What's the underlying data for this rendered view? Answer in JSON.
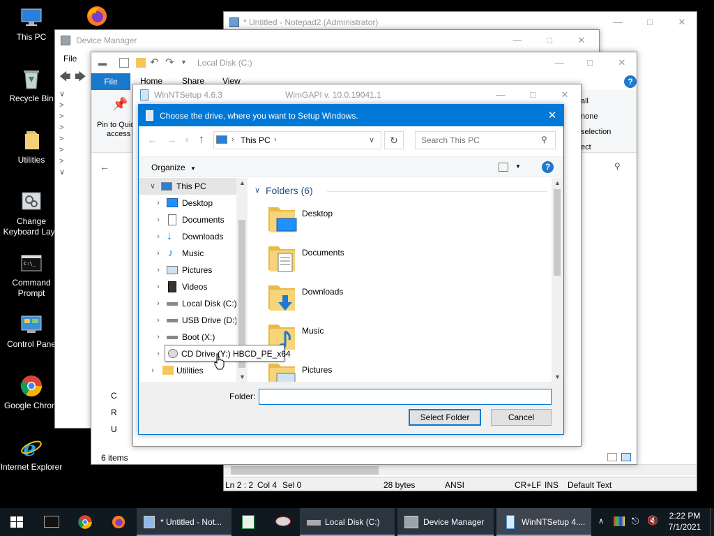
{
  "desktop": {
    "icons": [
      {
        "label": "This PC",
        "icon": "this-pc-icon"
      },
      {
        "label": "Recycle Bin",
        "icon": "recycle-bin-icon"
      },
      {
        "label": "Utilities",
        "icon": "folder-icon"
      },
      {
        "label": "Change Keyboard Layo",
        "icon": "keyboard-icon"
      },
      {
        "label": "Command Prompt",
        "icon": "command-prompt-icon"
      },
      {
        "label": "Control Pane",
        "icon": "control-panel-icon"
      },
      {
        "label": "Google Chrom",
        "icon": "chrome-icon"
      },
      {
        "label": "Internet Explorer",
        "icon": "internet-explorer-icon"
      }
    ]
  },
  "notepad": {
    "title": "* Untitled - Notepad2 (Administrator)",
    "status": {
      "position": "Ln 2 : 2",
      "col": "Col 4",
      "sel": "Sel 0",
      "size": "28 bytes",
      "encoding": "ANSI",
      "eol": "CR+LF",
      "ins": "INS",
      "scheme": "Default Text"
    }
  },
  "device_manager": {
    "title": "Device Manager",
    "menu_file": "File"
  },
  "explorer": {
    "title": "Local Disk (C:)",
    "tab_file": "File",
    "tab_home": "Home",
    "tab_share": "Share",
    "tab_view": "View",
    "pin_label_1": "Pin to Quic",
    "pin_label_2": "access",
    "right_select_all": "all",
    "right_select_none": "none",
    "right_invert": "selection",
    "right_select": "ect",
    "status_items": "6 items",
    "nav_items": [
      "Utilities"
    ],
    "tree_letters": [
      "C",
      "R",
      "U"
    ]
  },
  "winntsetup": {
    "title": "WinNTSetup 4.6.3",
    "api": "WimGAPI v. 10.0.19041.1"
  },
  "dialog": {
    "title": "Choose the drive, where you want to Setup Windows.",
    "breadcrumb_root": "This PC",
    "search_placeholder": "Search This PC",
    "organize": "Organize",
    "folders_header": "Folders (6)",
    "tree": [
      {
        "label": "This PC",
        "icon": "this-pc-icon",
        "level": 0,
        "expanded": true,
        "selected": true
      },
      {
        "label": "Desktop",
        "icon": "desktop-icon",
        "level": 1
      },
      {
        "label": "Documents",
        "icon": "documents-icon",
        "level": 1
      },
      {
        "label": "Downloads",
        "icon": "downloads-icon",
        "level": 1
      },
      {
        "label": "Music",
        "icon": "music-icon",
        "level": 1
      },
      {
        "label": "Pictures",
        "icon": "pictures-icon",
        "level": 1
      },
      {
        "label": "Videos",
        "icon": "videos-icon",
        "level": 1
      },
      {
        "label": "Local Disk (C:)",
        "icon": "drive-icon",
        "level": 1
      },
      {
        "label": "USB Drive (D:)",
        "icon": "drive-icon",
        "level": 1
      },
      {
        "label": "Boot (X:)",
        "icon": "drive-icon",
        "level": 1
      },
      {
        "label": "CD Drive (Y:) HBCD_PE_x64",
        "icon": "cd-drive-icon",
        "level": 1,
        "hovered": true
      },
      {
        "label": "Utilities",
        "icon": "folder-icon",
        "level": 0
      }
    ],
    "folders": [
      {
        "label": "Desktop",
        "icon": "desktop-folder-icon"
      },
      {
        "label": "Documents",
        "icon": "documents-folder-icon"
      },
      {
        "label": "Downloads",
        "icon": "downloads-folder-icon"
      },
      {
        "label": "Music",
        "icon": "music-folder-icon"
      },
      {
        "label": "Pictures",
        "icon": "pictures-folder-icon"
      }
    ],
    "folder_label": "Folder:",
    "folder_value": "",
    "select_button": "Select Folder",
    "cancel_button": "Cancel"
  },
  "taskbar": {
    "items": [
      {
        "label": "* Untitled - Not...",
        "icon": "notepad-icon"
      },
      {
        "label": "Local Disk (C:)",
        "icon": "drive-icon"
      },
      {
        "label": "Device Manager",
        "icon": "device-manager-icon"
      },
      {
        "label": "WinNTSetup 4....",
        "icon": "winntsetup-icon",
        "active": true
      }
    ],
    "time": "2:22 PM",
    "date": "7/1/2021"
  },
  "colors": {
    "dialog_title_bg": "#0078d7",
    "folder_yellow": "#f4c75c",
    "accent_blue": "#1f78d1",
    "taskbar_bg": "#101820"
  }
}
